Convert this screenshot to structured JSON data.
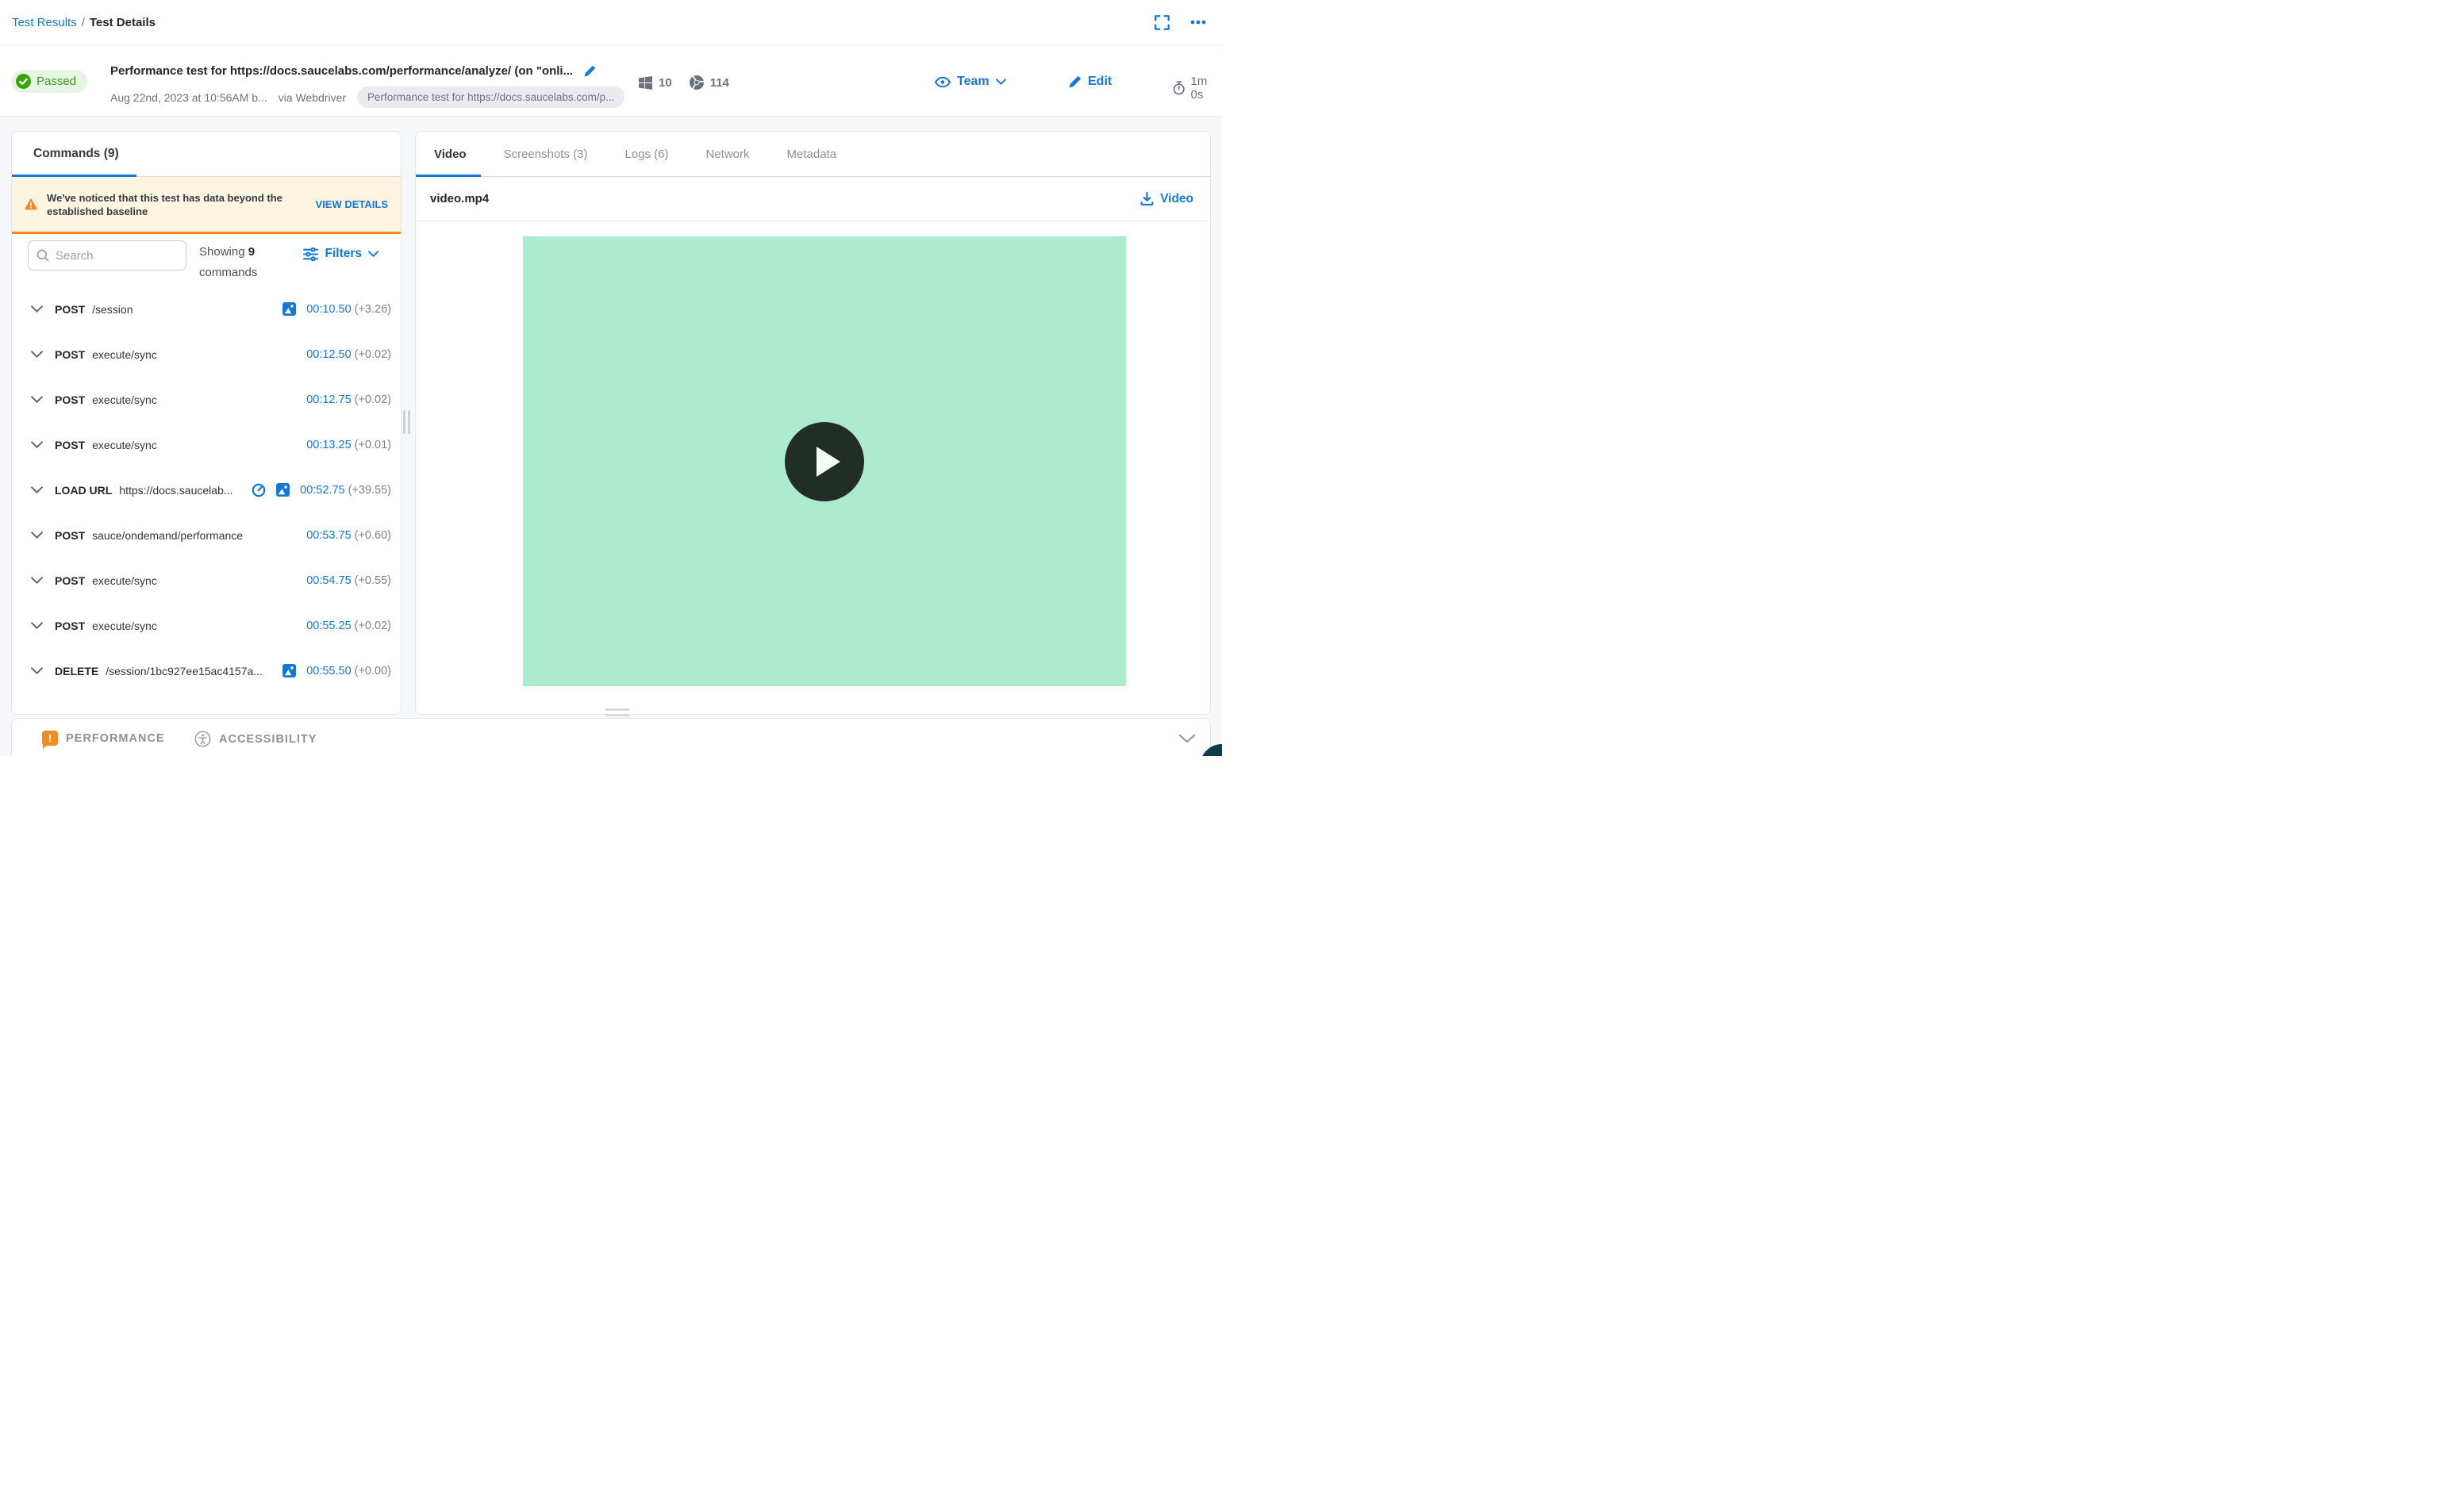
{
  "breadcrumb": {
    "link": "Test Results",
    "separator": "/",
    "current": "Test Details"
  },
  "header": {
    "status": "Passed",
    "title": "Performance test for https://docs.saucelabs.com/performance/analyze/ (on \"onli...",
    "date": "Aug 22nd, 2023 at 10:56AM b...",
    "via": "via Webdriver",
    "tag": "Performance test for https://docs.saucelabs.com/p...",
    "os_version": "10",
    "browser_version": "114",
    "team_label": "Team",
    "edit_label": "Edit",
    "duration": "1m 0s"
  },
  "commands_panel": {
    "tab_label": "Commands (9)",
    "warning": {
      "text": "We've noticed that this test has data beyond the established baseline",
      "action": "VIEW DETAILS"
    },
    "search_placeholder": "Search",
    "showing": {
      "prefix": "Showing ",
      "count": "9",
      "suffix": " commands"
    },
    "filters_label": "Filters",
    "commands": [
      {
        "method": "POST",
        "path": "/session",
        "icons": [
          "screenshot"
        ],
        "time": "00:10.50",
        "delta": "(+3.26)"
      },
      {
        "method": "POST",
        "path": "execute/sync",
        "icons": [],
        "time": "00:12.50",
        "delta": "(+0.02)"
      },
      {
        "method": "POST",
        "path": "execute/sync",
        "icons": [],
        "time": "00:12.75",
        "delta": "(+0.02)"
      },
      {
        "method": "POST",
        "path": "execute/sync",
        "icons": [],
        "time": "00:13.25",
        "delta": "(+0.01)"
      },
      {
        "method": "LOAD URL",
        "path": "https://docs.saucelab...",
        "icons": [
          "speedometer",
          "screenshot"
        ],
        "time": "00:52.75",
        "delta": "(+39.55)"
      },
      {
        "method": "POST",
        "path": "sauce/ondemand/performance",
        "icons": [],
        "time": "00:53.75",
        "delta": "(+0.60)"
      },
      {
        "method": "POST",
        "path": "execute/sync",
        "icons": [],
        "time": "00:54.75",
        "delta": "(+0.55)"
      },
      {
        "method": "POST",
        "path": "execute/sync",
        "icons": [],
        "time": "00:55.25",
        "delta": "(+0.02)"
      },
      {
        "method": "DELETE",
        "path": "/session/1bc927ee15ac4157a...",
        "icons": [
          "screenshot"
        ],
        "time": "00:55.50",
        "delta": "(+0.00)"
      }
    ]
  },
  "details_panel": {
    "tabs": [
      {
        "label": "Video",
        "active": true
      },
      {
        "label": "Screenshots (3)",
        "active": false
      },
      {
        "label": "Logs (6)",
        "active": false
      },
      {
        "label": "Network",
        "active": false
      },
      {
        "label": "Metadata",
        "active": false
      }
    ],
    "file_name": "video.mp4",
    "download_label": "Video"
  },
  "bottom_bar": {
    "performance_label": "PERFORMANCE",
    "accessibility_label": "ACCESSIBILITY"
  },
  "colors": {
    "accent_blue": "#1577d9",
    "passed_green": "#339c10",
    "warning_orange": "#f08c1d",
    "video_background_green": "#adebcf",
    "play_button_dark": "#232d27"
  }
}
